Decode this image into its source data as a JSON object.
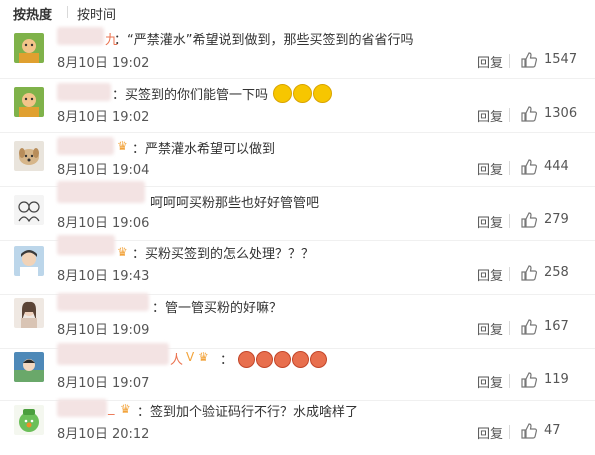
{
  "sort": {
    "hot": "按热度",
    "time": "按时间"
  },
  "comments": [
    {
      "name_tail": "九",
      "text": "：“严禁灌水”希望说到做到，那些买签到的省省行吗",
      "time": "8月10日 19:02",
      "reply": "回复",
      "likes": "1547"
    },
    {
      "name_tail": "",
      "text": "：买签到的你们能管一下吗",
      "emoji": [
        "yellow",
        "yellow",
        "yellow"
      ],
      "time": "8月10日 19:02",
      "reply": "回复",
      "likes": "1306"
    },
    {
      "name_tail": "",
      "vip": "♛",
      "text": "：严禁灌水希望可以做到",
      "time": "8月10日 19:04",
      "reply": "回复",
      "likes": "444"
    },
    {
      "name_tail": "",
      "text": "呵呵呵买粉那些也好好管管吧",
      "time": "8月10日 19:06",
      "reply": "回复",
      "likes": "279"
    },
    {
      "name_tail": "",
      "vip": "♛",
      "text": "：买粉买签到的怎么处理？？？",
      "time": "8月10日 19:43",
      "reply": "回复",
      "likes": "258"
    },
    {
      "name_tail": "",
      "text": "：管一管买粉的好嘛？",
      "time": "8月10日 19:09",
      "reply": "回复",
      "likes": "167"
    },
    {
      "name_tail": "人",
      "vip": "V ♛",
      "text": "：",
      "emoji": [
        "red",
        "red",
        "red",
        "red",
        "red"
      ],
      "time": "8月10日 19:07",
      "reply": "回复",
      "likes": "119"
    },
    {
      "name_tail": "_",
      "vip": "♛",
      "text": "：签到加个验证码行不行？水成啥样了",
      "time": "8月10日 20:12",
      "reply": "回复",
      "likes": "47"
    }
  ],
  "colors": {
    "name": "#eb7350",
    "text": "#333333",
    "muted": "#555555",
    "divider": "#f0f0f0"
  },
  "icons": {
    "like": "thumbs-up-icon",
    "vip": "crown-badge-icon"
  }
}
